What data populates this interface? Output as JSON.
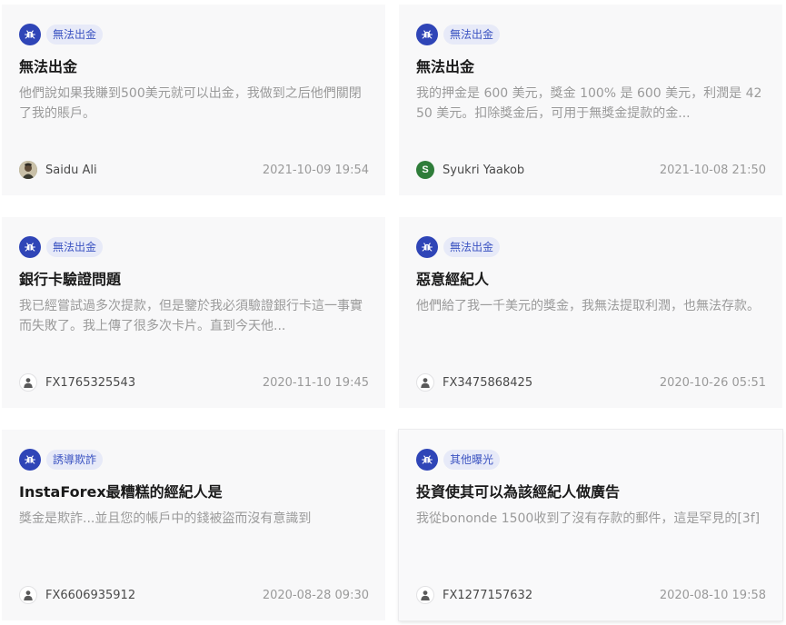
{
  "colors": {
    "accent": "#2f45b7",
    "tag_text": "#3c54c2",
    "tag_bg": "#e7eaf8",
    "card_bg": "#f8f8f9",
    "muted_text": "#9a9a9a"
  },
  "cards": [
    {
      "tag": "無法出金",
      "tag_icon": "bug-icon",
      "title": "無法出金",
      "excerpt": "他們說如果我賺到500美元就可以出金，我做到之后他們關閉了我的賬戶。",
      "author": "Saidu Ali",
      "avatar": "user-photo-avatar",
      "date": "2021-10-09 19:54"
    },
    {
      "tag": "無法出金",
      "tag_icon": "bug-icon",
      "title": "無法出金",
      "excerpt": "我的押金是 600 美元，獎金 100% 是 600 美元，利潤是 4250 美元。扣除獎金后，可用于無獎金提款的金...",
      "author": "Syukri Yaakob",
      "avatar_letter": "S",
      "avatar": "letter-avatar",
      "date": "2021-10-08 21:50"
    },
    {
      "tag": "無法出金",
      "tag_icon": "bug-icon",
      "title": "銀行卡驗證問題",
      "excerpt": "我已經嘗試過多次提款，但是鑒於我必須驗證銀行卡這一事實而失敗了。我上傳了很多次卡片。直到今天他...",
      "author": "FX1765325543",
      "avatar": "default-user-avatar",
      "date": "2020-11-10 19:45"
    },
    {
      "tag": "無法出金",
      "tag_icon": "bug-icon",
      "title": "惡意經紀人",
      "excerpt": "他們給了我一千美元的獎金，我無法提取利潤，也無法存款。",
      "author": "FX3475868425",
      "avatar": "default-user-avatar",
      "date": "2020-10-26 05:51"
    },
    {
      "tag": "誘導欺詐",
      "tag_icon": "bug-icon",
      "title": "InstaForex最糟糕的經紀人是",
      "excerpt": "獎金是欺詐...並且您的帳戶中的錢被盜而沒有意識到",
      "author": "FX6606935912",
      "avatar": "default-user-avatar",
      "date": "2020-08-28 09:30"
    },
    {
      "tag": "其他曝光",
      "tag_icon": "bug-icon",
      "title": "投資使其可以為該經紀人做廣告",
      "excerpt": "我從bononde 1500收到了沒有存款的郵件，這是罕見的[3f]",
      "author": "FX1277157632",
      "avatar": "default-user-avatar",
      "date": "2020-08-10 19:58"
    }
  ]
}
